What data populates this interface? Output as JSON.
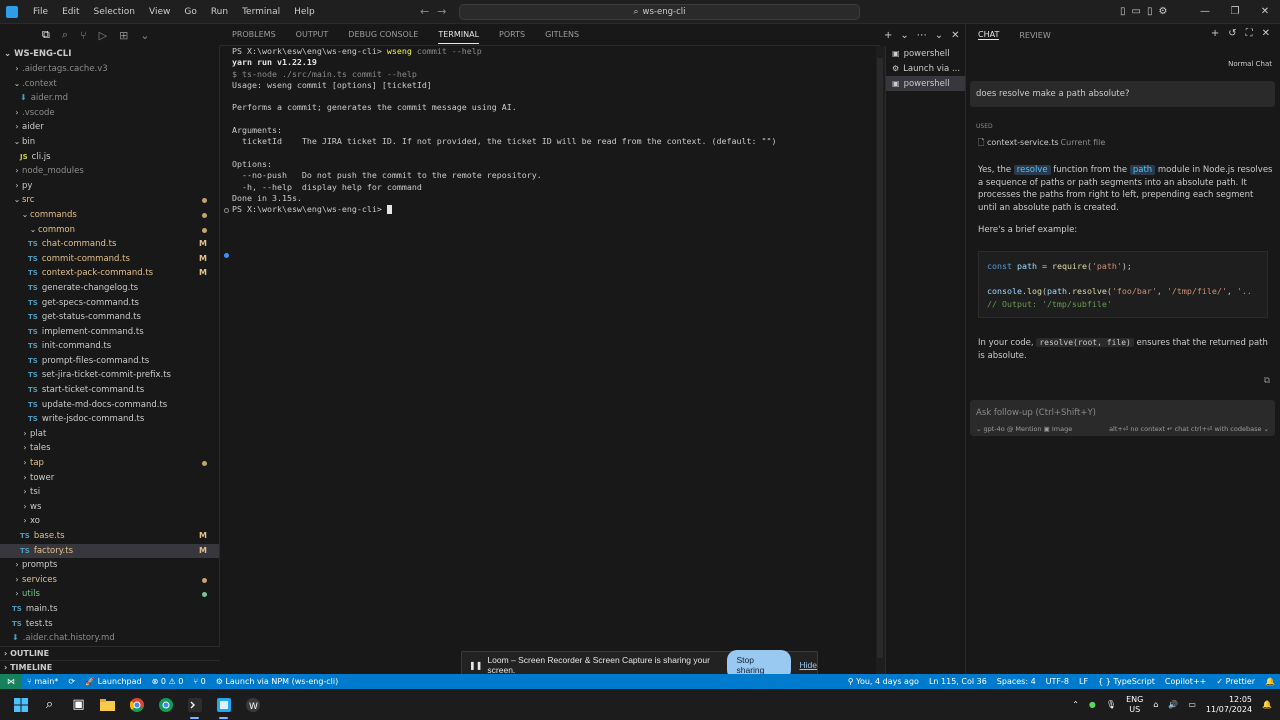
{
  "titlebar": {
    "menu": [
      "File",
      "Edit",
      "Selection",
      "View",
      "Go",
      "Run",
      "Terminal",
      "Help"
    ],
    "search": "ws-eng-cli"
  },
  "explorer": {
    "root": "WS-ENG-CLI",
    "items": [
      {
        "label": ".aider.tags.cache.v3",
        "kind": "folder",
        "indent": 1,
        "color": "ignored",
        "chev": "›"
      },
      {
        "label": ".context",
        "kind": "folder",
        "indent": 1,
        "color": "ignored",
        "chev": "⌄"
      },
      {
        "label": "aider.md",
        "kind": "md",
        "indent": 2,
        "color": "ignored"
      },
      {
        "label": ".vscode",
        "kind": "folder",
        "indent": 1,
        "color": "ignored",
        "chev": "›"
      },
      {
        "label": "aider",
        "kind": "folder",
        "indent": 1,
        "color": "default",
        "chev": "›"
      },
      {
        "label": "bin",
        "kind": "folder",
        "indent": 1,
        "color": "default",
        "chev": "⌄"
      },
      {
        "label": "cli.js",
        "kind": "js",
        "indent": 2,
        "color": "default"
      },
      {
        "label": "node_modules",
        "kind": "folder",
        "indent": 1,
        "color": "ignored",
        "chev": "›"
      },
      {
        "label": "py",
        "kind": "folder",
        "indent": 1,
        "color": "default",
        "chev": "›"
      },
      {
        "label": "src",
        "kind": "folder",
        "indent": 1,
        "color": "modified",
        "chev": "⌄",
        "dot": "#c5a36b"
      },
      {
        "label": "commands",
        "kind": "folder",
        "indent": 2,
        "color": "modified",
        "chev": "⌄",
        "dot": "#c5a36b"
      },
      {
        "label": "common",
        "kind": "folder",
        "indent": 3,
        "color": "modified",
        "chev": "⌄",
        "dot": "#c5a36b"
      },
      {
        "label": "chat-command.ts",
        "kind": "ts",
        "indent": 3,
        "color": "modified",
        "status": "M"
      },
      {
        "label": "commit-command.ts",
        "kind": "ts",
        "indent": 3,
        "color": "modified",
        "status": "M"
      },
      {
        "label": "context-pack-command.ts",
        "kind": "ts",
        "indent": 3,
        "color": "modified",
        "status": "M"
      },
      {
        "label": "generate-changelog.ts",
        "kind": "ts",
        "indent": 3,
        "color": "default"
      },
      {
        "label": "get-specs-command.ts",
        "kind": "ts",
        "indent": 3,
        "color": "default"
      },
      {
        "label": "get-status-command.ts",
        "kind": "ts",
        "indent": 3,
        "color": "default"
      },
      {
        "label": "implement-command.ts",
        "kind": "ts",
        "indent": 3,
        "color": "default"
      },
      {
        "label": "init-command.ts",
        "kind": "ts",
        "indent": 3,
        "color": "default"
      },
      {
        "label": "prompt-files-command.ts",
        "kind": "ts",
        "indent": 3,
        "color": "default"
      },
      {
        "label": "set-jira-ticket-commit-prefix.ts",
        "kind": "ts",
        "indent": 3,
        "color": "default"
      },
      {
        "label": "start-ticket-command.ts",
        "kind": "ts",
        "indent": 3,
        "color": "default"
      },
      {
        "label": "update-md-docs-command.ts",
        "kind": "ts",
        "indent": 3,
        "color": "default"
      },
      {
        "label": "write-jsdoc-command.ts",
        "kind": "ts",
        "indent": 3,
        "color": "default"
      },
      {
        "label": "plat",
        "kind": "folder",
        "indent": 2,
        "color": "default",
        "chev": "›"
      },
      {
        "label": "tales",
        "kind": "folder",
        "indent": 2,
        "color": "default",
        "chev": "›"
      },
      {
        "label": "tap",
        "kind": "folder",
        "indent": 2,
        "color": "modified",
        "chev": "›",
        "dot": "#c5a36b"
      },
      {
        "label": "tower",
        "kind": "folder",
        "indent": 2,
        "color": "default",
        "chev": "›"
      },
      {
        "label": "tsi",
        "kind": "folder",
        "indent": 2,
        "color": "default",
        "chev": "›"
      },
      {
        "label": "ws",
        "kind": "folder",
        "indent": 2,
        "color": "default",
        "chev": "›"
      },
      {
        "label": "xo",
        "kind": "folder",
        "indent": 2,
        "color": "default",
        "chev": "›"
      },
      {
        "label": "base.ts",
        "kind": "ts",
        "indent": 2,
        "color": "modified",
        "status": "M"
      },
      {
        "label": "factory.ts",
        "kind": "ts",
        "indent": 2,
        "color": "modified",
        "status": "M",
        "selected": true
      },
      {
        "label": "prompts",
        "kind": "folder",
        "indent": 1,
        "color": "default",
        "chev": "›"
      },
      {
        "label": "services",
        "kind": "folder",
        "indent": 1,
        "color": "modified",
        "chev": "›",
        "dot": "#c5a36b"
      },
      {
        "label": "utils",
        "kind": "folder",
        "indent": 1,
        "color": "green",
        "chev": "›",
        "dot": "#73c991"
      },
      {
        "label": "main.ts",
        "kind": "ts",
        "indent": 1,
        "color": "default"
      },
      {
        "label": "test.ts",
        "kind": "ts",
        "indent": 1,
        "color": "default"
      },
      {
        "label": ".aider.chat.history.md",
        "kind": "md",
        "indent": 1,
        "color": "ignored"
      }
    ],
    "outline": "OUTLINE",
    "timeline": "TIMELINE"
  },
  "panel": {
    "tabs": [
      "PROBLEMS",
      "OUTPUT",
      "DEBUG CONSOLE",
      "TERMINAL",
      "PORTS",
      "GITLENS"
    ],
    "active_tab": "TERMINAL",
    "terminals": [
      "powershell",
      "Launch via ...",
      "powershell"
    ]
  },
  "terminal": {
    "prompt1": "PS X:\\work\\esw\\eng\\ws-eng-cli> ",
    "cmd1": "wseng",
    "cmd1_args": " commit --help",
    "yarn": "yarn run v1.22.19",
    "tsnode": "$ ts-node ./src/main.ts commit --help",
    "usage": "Usage: wseng commit [options] [ticketId]",
    "blank1": "",
    "desc": "Performs a commit; generates the commit message using AI.",
    "blank2": "",
    "args_header": "Arguments:",
    "arg_ticket": "  ticketId    The JIRA ticket ID. If not provided, the ticket ID will be read from the context. (default: \"\")",
    "blank3": "",
    "opts_header": "Options:",
    "opt_nopush": "  --no-push   Do not push the commit to the remote repository.",
    "opt_help": "  -h, --help  display help for command",
    "done": "Done in 3.15s.",
    "prompt2": "PS X:\\work\\esw\\eng\\ws-eng-cli> "
  },
  "chat": {
    "tabs": [
      "CHAT",
      "REVIEW"
    ],
    "mode": "Normal Chat",
    "question": "does resolve make a path absolute?",
    "used_label": "USED",
    "used_file": "context-service.ts",
    "used_sub": "Current file",
    "a1_pre": "Yes, the ",
    "a1_resolve": "resolve",
    "a1_mid": " function from the ",
    "a1_path": "path",
    "a1_post": " module in Node.js resolves a sequence of paths or path segments into an absolute path. It processes the paths from right to left, prepending each segment until an absolute path is created.",
    "a2": "Here's a brief example:",
    "code_l1_kw": "const",
    "code_l1_var": "path",
    "code_l1_eq": " = ",
    "code_l1_fn": "require",
    "code_l1_str": "'path'",
    "code_l3_obj": "console",
    "code_l3_fn": "log",
    "code_l3_path": "path",
    "code_l3_fn2": "resolve",
    "code_l3_s1": "'foo/bar'",
    "code_l3_s2": "'/tmp/file/'",
    "code_l3_s3": "'..",
    "code_l4": "// Output: '/tmp/subfile'",
    "a3_pre": "In your code, ",
    "a3_code": "resolve(root, file)",
    "a3_post": " ensures that the returned path is absolute.",
    "followup_placeholder": "Ask follow-up (Ctrl+Shift+Y)",
    "followup_left": "⌄ gpt-4o   @ Mention   ▣ Image",
    "followup_right": "alt+⏎ no context   ↵ chat   ctrl+⏎ with codebase ⌄"
  },
  "loom": {
    "message": "Loom – Screen Recorder & Screen Capture is sharing your screen.",
    "stop": "Stop sharing",
    "hide": "Hide"
  },
  "statusbar": {
    "branch": "main*",
    "launchpad": "Launchpad",
    "errors": "⊗ 0 ⚠ 0",
    "ports": "⑂ 0",
    "launch": "Launch via NPM (ws-eng-cli)",
    "blame": "You, 4 days ago",
    "position": "Ln 115, Col 36",
    "spaces": "Spaces: 4",
    "encoding": "UTF-8",
    "eol": "LF",
    "language": "{ } TypeScript",
    "copilot": "Copilot++",
    "prettier": "✓ Prettier"
  },
  "taskbar": {
    "lang_top": "ENG",
    "lang_bottom": "US",
    "time": "12:05",
    "date": "11/07/2024"
  },
  "colors": {
    "accent": "#007acc",
    "modified": "#e2c08d",
    "untracked": "#73c991"
  }
}
